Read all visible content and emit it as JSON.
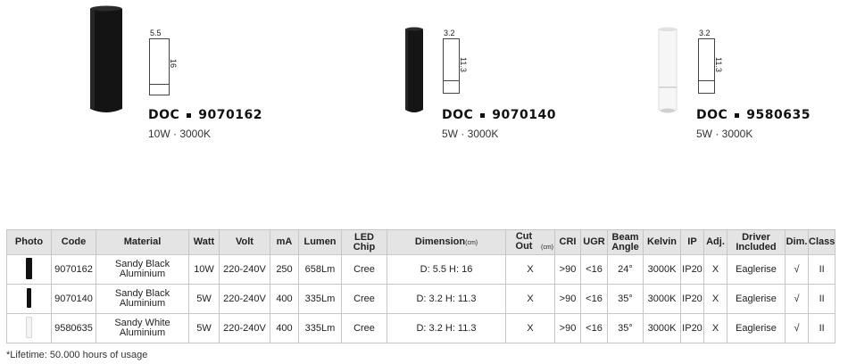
{
  "products": [
    {
      "brand": "DOC",
      "code": "9070162",
      "spec": "10W · 3000K",
      "dim_w": "5.5",
      "dim_h": "16",
      "color": "#111111"
    },
    {
      "brand": "DOC",
      "code": "9070140",
      "spec": "5W · 3000K",
      "dim_w": "3.2",
      "dim_h": "11.3",
      "color": "#111111"
    },
    {
      "brand": "DOC",
      "code": "9580635",
      "spec": "5W · 3000K",
      "dim_w": "3.2",
      "dim_h": "11.3",
      "color": "#f5f5f5"
    }
  ],
  "table": {
    "headers": {
      "photo": "Photo",
      "code": "Code",
      "material": "Material",
      "watt": "Watt",
      "volt": "Volt",
      "ma": "mA",
      "lumen": "Lumen",
      "led_chip": "LED Chip",
      "dimension": "Dimension",
      "dimension_unit": "(cm)",
      "cut_out": "Cut Out",
      "cut_out_unit": "(cm)",
      "cri": "CRI",
      "ugr": "UGR",
      "beam_angle": "Beam Angle",
      "kelvin": "Kelvin",
      "ip": "IP",
      "adj": "Adj.",
      "driver": "Driver Included",
      "dim": "Dim.",
      "class": "Class"
    },
    "rows": [
      {
        "code": "9070162",
        "material": "Sandy Black Aluminium",
        "watt": "10W",
        "volt": "220-240V",
        "ma": "250",
        "lumen": "658Lm",
        "led_chip": "Cree",
        "dimension": "D: 5.5 H: 16",
        "cut_out": "X",
        "cri": ">90",
        "ugr": "<16",
        "beam_angle": "24°",
        "kelvin": "3000K",
        "ip": "IP20",
        "adj": "X",
        "driver": "Eaglerise",
        "dim": "√",
        "class": "II"
      },
      {
        "code": "9070140",
        "material": "Sandy Black Aluminium",
        "watt": "5W",
        "volt": "220-240V",
        "ma": "400",
        "lumen": "335Lm",
        "led_chip": "Cree",
        "dimension": "D: 3.2 H: 11.3",
        "cut_out": "X",
        "cri": ">90",
        "ugr": "<16",
        "beam_angle": "35°",
        "kelvin": "3000K",
        "ip": "IP20",
        "adj": "X",
        "driver": "Eaglerise",
        "dim": "√",
        "class": "II"
      },
      {
        "code": "9580635",
        "material": "Sandy White Aluminium",
        "watt": "5W",
        "volt": "220-240V",
        "ma": "400",
        "lumen": "335Lm",
        "led_chip": "Cree",
        "dimension": "D: 3.2 H: 11.3",
        "cut_out": "X",
        "cri": ">90",
        "ugr": "<16",
        "beam_angle": "35°",
        "kelvin": "3000K",
        "ip": "IP20",
        "adj": "X",
        "driver": "Eaglerise",
        "dim": "√",
        "class": "II"
      }
    ]
  },
  "footnote": "*Lifetime: 50.000 hours of usage"
}
